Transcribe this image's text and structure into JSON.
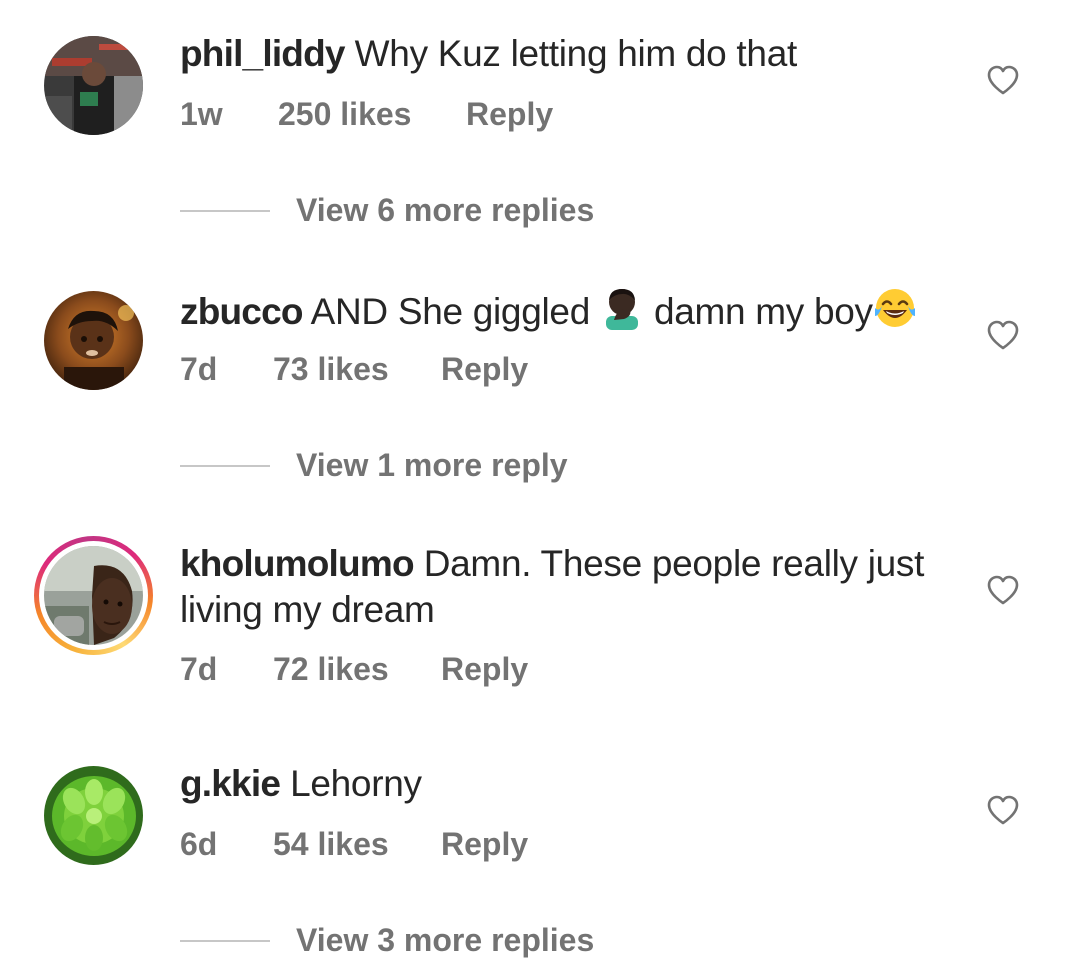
{
  "comments": [
    {
      "username": "phil_liddy",
      "text": "Why Kuz letting him do that",
      "time": "1w",
      "likes": "250 likes",
      "reply": "Reply",
      "view_replies": "View 6 more replies"
    },
    {
      "username": "zbucco",
      "text_before_emoji": "AND She giggled",
      "text_middle": "damn my boy",
      "emoji_1": "face-palm-emoji",
      "emoji_2": "tears-of-joy-emoji",
      "time": "7d",
      "likes": "73 likes",
      "reply": "Reply",
      "view_replies": "View 1 more reply"
    },
    {
      "username": "kholumolumo",
      "text": "Damn. These people really just living my dream",
      "time": "7d",
      "likes": "72 likes",
      "reply": "Reply",
      "has_story_ring": true
    },
    {
      "username": "g.kkie",
      "text": "Lehorny",
      "time": "6d",
      "likes": "54 likes",
      "reply": "Reply",
      "view_replies": "View 3 more replies"
    }
  ],
  "icons": {
    "like": "heart-outline-icon"
  },
  "colors": {
    "text": "#262626",
    "secondary": "#737373",
    "divider": "#c7c7c7",
    "story_ring": [
      "#f58529",
      "#dd2a7b",
      "#feda75"
    ]
  }
}
